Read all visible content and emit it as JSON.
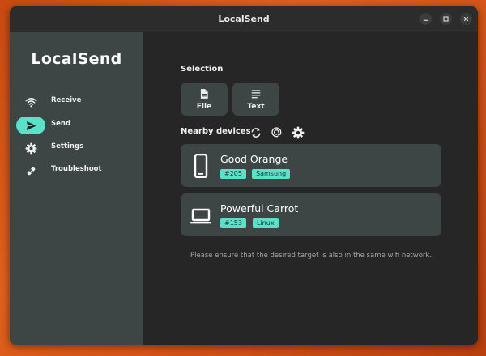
{
  "window": {
    "title": "LocalSend"
  },
  "sidebar": {
    "app_name": "LocalSend",
    "items": [
      {
        "label": "Receive",
        "icon": "wifi-icon",
        "active": false
      },
      {
        "label": "Send",
        "icon": "send-icon",
        "active": true
      },
      {
        "label": "Settings",
        "icon": "gear-icon",
        "active": false
      },
      {
        "label": "Troubleshoot",
        "icon": "troubleshoot-icon",
        "active": false
      }
    ]
  },
  "main": {
    "selection_label": "Selection",
    "selection_buttons": [
      {
        "label": "File",
        "icon": "file-icon"
      },
      {
        "label": "Text",
        "icon": "text-icon"
      }
    ],
    "nearby_label": "Nearby devices",
    "nearby_actions": [
      "refresh-icon",
      "scan-target-icon",
      "gear-icon"
    ],
    "devices": [
      {
        "name": "Good Orange",
        "tags": [
          "#205",
          "Samsung"
        ],
        "icon": "phone-icon"
      },
      {
        "name": "Powerful Carrot",
        "tags": [
          "#153",
          "Linux"
        ],
        "icon": "laptop-icon"
      }
    ],
    "hint": "Please ensure that the desired target is also in the same wifi network."
  },
  "colors": {
    "accent": "#5ce0c8",
    "sidebar_bg": "#3d4644",
    "window_bg": "#262626",
    "desktop": "#d4541a"
  }
}
